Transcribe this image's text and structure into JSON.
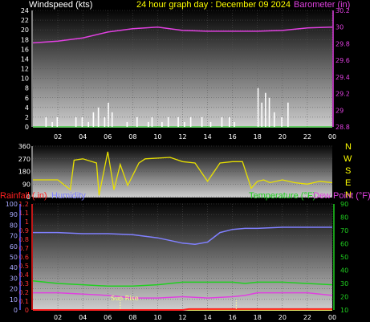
{
  "header": {
    "windspeed_label": "Windspeed (kts)",
    "title": "24 hour graph day : December 09 2024",
    "barometer_label": "Barometer (in)"
  },
  "lower_header": {
    "rainfall_label": "Rainfall (.in)",
    "humidity_label": "Humidity",
    "temperature_label": "Temperature (°F)",
    "dewpoint_label": "Dew Point (°F)"
  },
  "compass": [
    "N",
    "W",
    "S",
    "E",
    "N"
  ],
  "annotations": {
    "sunrise": "Sun Rise"
  },
  "colors": {
    "wind": "#ffffff",
    "barometer": "#e040e0",
    "direction": "#e8e000",
    "humidity": "#8080ff",
    "temperature": "#20d020",
    "dewpoint": "#e040e0",
    "rain": "#ff2020"
  },
  "chart_data": [
    {
      "type": "bar",
      "name": "windspeed",
      "xlabel": "",
      "ylabel": "Windspeed (kts)",
      "x_ticks": [
        "02",
        "04",
        "06",
        "08",
        "10",
        "12",
        "14",
        "16",
        "18",
        "20",
        "22",
        "00"
      ],
      "xlim": [
        0,
        24
      ],
      "ylim": [
        0,
        24
      ],
      "y_ticks": [
        0,
        2,
        4,
        6,
        8,
        10,
        12,
        14,
        16,
        18,
        20,
        22,
        24
      ],
      "x": [
        1.0,
        1.5,
        1.9,
        3.4,
        3.9,
        4.4,
        4.8,
        5.2,
        5.7,
        6.0,
        6.3,
        7.5,
        8.3,
        9.2,
        9.5,
        10.3,
        10.8,
        11.6,
        12.1,
        12.6,
        13.5,
        14.2,
        15.1,
        15.7,
        16.1,
        18.0,
        18.3,
        18.6,
        18.9,
        19.3,
        19.9,
        20.4
      ],
      "values": [
        2,
        1,
        2,
        2,
        2,
        1,
        3,
        4,
        2,
        5,
        3,
        1,
        2,
        1,
        2,
        1,
        2,
        2,
        1,
        2,
        2,
        1,
        2,
        2,
        1,
        8,
        5,
        7,
        6,
        3,
        2,
        5
      ]
    },
    {
      "type": "line",
      "name": "barometer",
      "ylabel": "Barometer (in)",
      "ylim": [
        28.8,
        30.2
      ],
      "y_ticks": [
        28.8,
        29,
        29.2,
        29.4,
        29.6,
        29.8,
        30,
        30.2
      ],
      "x": [
        0,
        2,
        4,
        6,
        8,
        10,
        12,
        14,
        16,
        18,
        20,
        22,
        24
      ],
      "values": [
        29.81,
        29.83,
        29.87,
        29.94,
        29.98,
        30.0,
        29.96,
        29.95,
        29.95,
        29.95,
        29.96,
        29.99,
        30.0
      ]
    },
    {
      "type": "line",
      "name": "wind direction",
      "ylim": [
        0,
        360
      ],
      "y_ticks": [
        0,
        90,
        180,
        270,
        360
      ],
      "x": [
        0,
        2,
        3,
        3.3,
        4,
        5.1,
        5.3,
        6,
        6.5,
        7,
        7.6,
        8.5,
        9,
        11,
        12,
        13,
        14,
        15,
        16,
        16.8,
        17.5,
        18,
        18.5,
        19,
        20,
        21,
        22,
        23,
        24
      ],
      "values": [
        120,
        120,
        50,
        260,
        270,
        240,
        10,
        320,
        50,
        230,
        80,
        240,
        270,
        280,
        250,
        240,
        110,
        240,
        250,
        250,
        60,
        110,
        120,
        100,
        120,
        100,
        90,
        110,
        100
      ]
    },
    {
      "type": "line",
      "name": "humidity / temperature / dew point / rainfall",
      "y_left_ticks": [
        0,
        10,
        20,
        30,
        40,
        50,
        60,
        70,
        80,
        90,
        100
      ],
      "y_rain_ticks": [
        0,
        0.1,
        0.2,
        0.3,
        0.4,
        0.5,
        0.6,
        0.7,
        0.8,
        0.9,
        1,
        1.1,
        1.2
      ],
      "y_right_ticks": [
        10,
        20,
        30,
        40,
        50,
        60,
        70,
        80,
        90
      ],
      "series": [
        {
          "name": "Humidity",
          "scale": "left",
          "x": [
            0,
            2,
            4,
            6,
            8,
            10,
            12,
            13,
            14,
            15,
            16,
            17,
            18,
            20,
            22,
            24
          ],
          "values": [
            73,
            73,
            72,
            72,
            71,
            68,
            63,
            62,
            64,
            73,
            76,
            77,
            77,
            78,
            78,
            78
          ]
        },
        {
          "name": "Temperature (°F)",
          "scale": "right",
          "x": [
            0,
            2,
            4,
            6,
            8,
            10,
            12,
            14,
            16,
            17,
            18,
            20,
            22,
            24
          ],
          "values": [
            32,
            30,
            29,
            28,
            28,
            29,
            31,
            31,
            31,
            30,
            31,
            31,
            30,
            29
          ]
        },
        {
          "name": "Dew Point (°F)",
          "scale": "right",
          "x": [
            0,
            2,
            4,
            6,
            8,
            10,
            12,
            14,
            16,
            17,
            18,
            20,
            22,
            24
          ],
          "values": [
            23,
            23,
            22,
            21,
            19,
            19,
            20,
            19,
            20,
            21,
            23,
            23,
            23,
            21
          ]
        },
        {
          "name": "Rainfall (.in)",
          "scale": "rain",
          "x": [
            0,
            12,
            12.5,
            24
          ],
          "values": [
            0,
            0,
            0.01,
            0.01
          ]
        }
      ]
    }
  ]
}
